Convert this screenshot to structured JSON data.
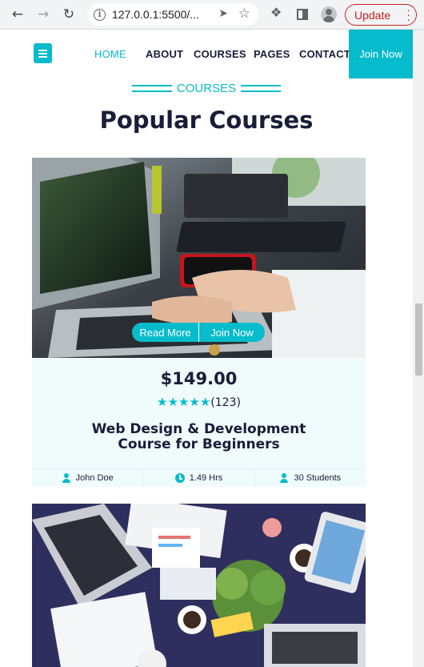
{
  "browser": {
    "url": "127.0.0.1:5500/...",
    "update_label": "Update"
  },
  "nav": {
    "links": [
      "HOME",
      "ABOUT",
      "COURSES",
      "PAGES",
      "CONTACT"
    ],
    "join_label": "Join Now"
  },
  "section": {
    "tag": "COURSES",
    "title": "Popular Courses"
  },
  "course": {
    "read_more": "Read More",
    "join_now": "Join Now",
    "price": "$149.00",
    "stars": "★★★★★",
    "rating_count": "(123)",
    "title_line1": "Web Design & Development",
    "title_line2": "Course for Beginners",
    "instructor": "John Doe",
    "duration": "1.49 Hrs",
    "students": "30 Students"
  },
  "colors": {
    "primary": "#06bbcc",
    "dark": "#181d38",
    "card_bg": "#f0fbfc",
    "update_red": "#c5221f"
  },
  "icons": [
    "back-arrow-icon",
    "forward-arrow-icon",
    "reload-icon",
    "info-icon",
    "send-icon",
    "star-icon",
    "puzzle-icon",
    "side-panel-icon",
    "profile-icon",
    "book-logo-icon",
    "user-icon",
    "clock-icon"
  ]
}
